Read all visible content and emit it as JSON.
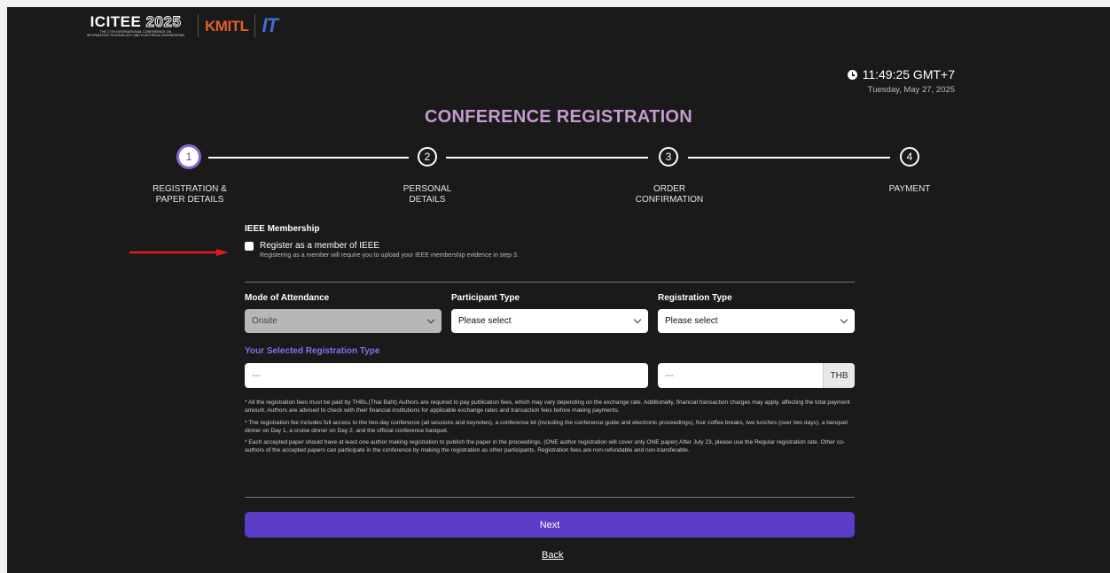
{
  "header": {
    "logo_icitee": "ICITEE",
    "logo_icitee_year": "2025",
    "logo_icitee_sub1": "THE 17TH INTERNATIONAL CONFERENCE ON",
    "logo_icitee_sub2": "INFORMATION TECHNOLOGY AND ELECTRICAL ENGINEERING",
    "logo_kmitl": "KMITL",
    "logo_it": "IT"
  },
  "clock": {
    "time": "11:49:25 GMT+7",
    "date": "Tuesday, May 27, 2025"
  },
  "page_title": "CONFERENCE REGISTRATION",
  "steps": [
    {
      "number": "1",
      "label_line1": "REGISTRATION &",
      "label_line2": "PAPER DETAILS"
    },
    {
      "number": "2",
      "label_line1": "PERSONAL",
      "label_line2": "DETAILS"
    },
    {
      "number": "3",
      "label_line1": "ORDER",
      "label_line2": "CONFIRMATION"
    },
    {
      "number": "4",
      "label_line1": "PAYMENT",
      "label_line2": ""
    }
  ],
  "ieee": {
    "title": "IEEE Membership",
    "checkbox_label": "Register as a member of IEEE",
    "help": "Registering as a member will require you to upload your IEEE membership evidence in step 3."
  },
  "fields": {
    "mode_label": "Mode of Attendance",
    "mode_value": "Onsite",
    "participant_label": "Participant Type",
    "participant_value": "Please select",
    "registration_label": "Registration Type",
    "registration_value": "Please select"
  },
  "selected": {
    "title": "Your Selected Registration Type",
    "type_value": "---",
    "price_value": "---",
    "currency": "THB"
  },
  "notes": [
    "* All the registration fees must be paid by THBs.(Thai Baht) Authors are required to pay publication fees, which may vary depending on the exchange rate. Additionally, financial transaction charges may apply, affecting the total payment amount. Authors are advised to check with their financial institutions for applicable exchange rates and transaction fees before making payments.",
    "* The registration fee includes full access to the two-day conference (all sessions and keynotes), a conference kit (including the conference guide and electronic proceedings), four coffee breaks, two lunches (over two days), a banquet dinner on Day 1, a cruise dinner on Day 2, and the official conference banquet.",
    "* Each accepted paper should have at least one author making registration to publish the paper in the proceedings. (ONE author registration will cover only ONE paper) After July 23, please use the Regular registration rate. Other co-authors of the accepted papers can participate in the conference by making the registration as other participants. Registration fees are non-refundable and non-transferable."
  ],
  "buttons": {
    "next": "Next",
    "back": "Back"
  },
  "colors": {
    "accent": "#5b3cc4",
    "title": "#c49bd0",
    "arrow": "#e01b1b"
  }
}
